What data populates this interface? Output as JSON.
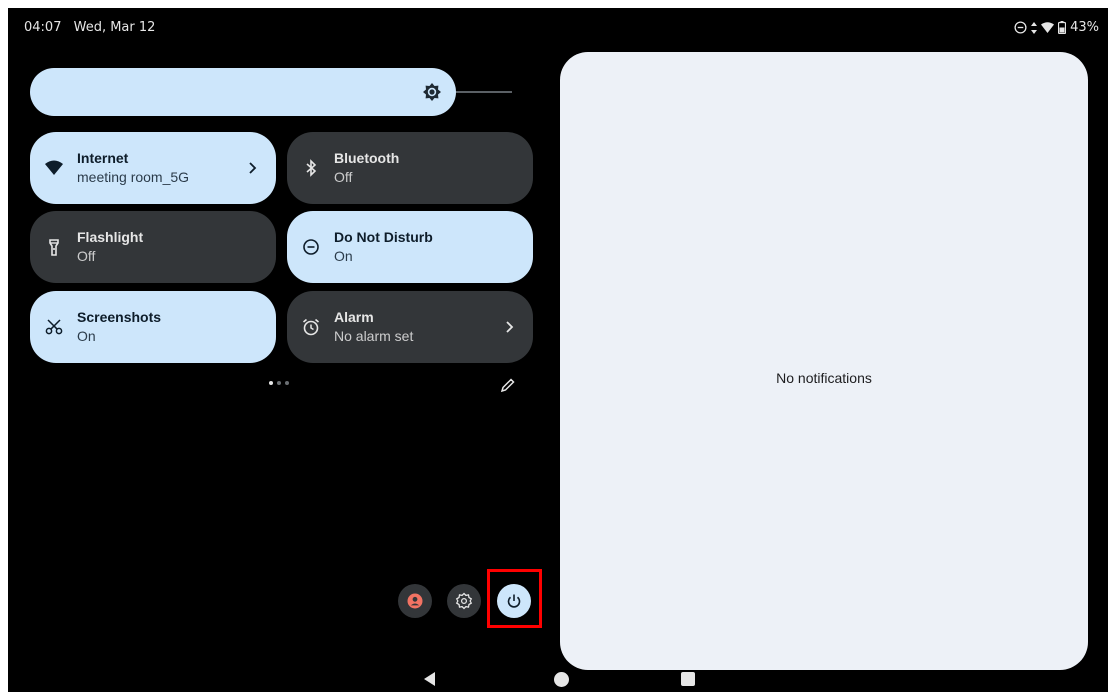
{
  "status_bar": {
    "time": "04:07",
    "date": "Wed, Mar 12",
    "battery": "43%"
  },
  "brightness": {
    "icon": "brightness-icon"
  },
  "tiles": [
    {
      "title": "Internet",
      "subtitle": "meeting room_5G",
      "icon": "wifi-icon",
      "state": "on",
      "has_chevron": true
    },
    {
      "title": "Bluetooth",
      "subtitle": "Off",
      "icon": "bluetooth-icon",
      "state": "off",
      "has_chevron": false
    },
    {
      "title": "Flashlight",
      "subtitle": "Off",
      "icon": "flashlight-icon",
      "state": "off",
      "has_chevron": false
    },
    {
      "title": "Do Not Disturb",
      "subtitle": "On",
      "icon": "do-not-disturb-icon",
      "state": "on",
      "has_chevron": false
    },
    {
      "title": "Screenshots",
      "subtitle": "On",
      "icon": "screenshot-icon",
      "state": "on",
      "has_chevron": false
    },
    {
      "title": "Alarm",
      "subtitle": "No alarm set",
      "icon": "alarm-icon",
      "state": "off",
      "has_chevron": true
    }
  ],
  "pager": {
    "pages": 3,
    "current": 1
  },
  "footer_buttons": [
    "user-switcher-button",
    "settings-button",
    "power-button"
  ],
  "notifications": {
    "empty_text": "No notifications"
  },
  "colors": {
    "tile_on": "#cde6fb",
    "tile_off": "#333639",
    "panel": "#edf1f7",
    "highlight": "#ff0000",
    "user_icon": "#f27363"
  }
}
